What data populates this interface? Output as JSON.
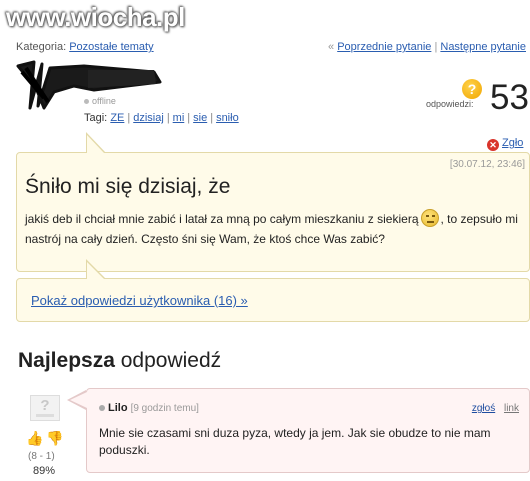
{
  "watermark": "www.wiocha.pl",
  "category": {
    "label": "Kategoria:",
    "value": "Pozostałe tematy"
  },
  "nav": {
    "prefix": "«",
    "prev": "Poprzednie pytanie",
    "separator": "|",
    "next": "Następne pytanie"
  },
  "user": {
    "status": "offline"
  },
  "tags": {
    "label": "Tagi:",
    "items": [
      "ZE",
      "dzisiaj",
      "mi",
      "sie",
      "sniło"
    ]
  },
  "answers": {
    "label": "odpowiedzi:",
    "count": "53",
    "icon": "question-icon"
  },
  "report": {
    "label": "Zgło",
    "icon": "close-icon"
  },
  "question": {
    "date": "[30.07.12, 23:46]",
    "title": "Śniło mi się dzisiaj, że",
    "body_part1": "jakiś deb il chciał mnie zabić i latał za mną po całym mieszkaniu z siekierą",
    "body_part2": ", to zepsuło mi nastrój na cały dzień. Często śni się Wam, że ktoś chce Was zabić?",
    "emoticon": "smiley-icon"
  },
  "show_answers": "Pokaż odpowiedzi użytkownika (16) »",
  "best_answer": {
    "heading_bold": "Najlepsza",
    "heading_rest": "odpowiedź",
    "author": "Lilo",
    "time": "[9 godzin temu]",
    "report_label": "zgłoś",
    "link_label": "link",
    "body": "Mnie sie czasami sni duza pyza, wtedy ja jem. Jak sie obudze to nie mam poduszki.",
    "votes": "(8 - 1)",
    "percent": "89%",
    "colors": {
      "thumb_up": "#c06ab0",
      "thumb_down": "#e0a020"
    }
  }
}
